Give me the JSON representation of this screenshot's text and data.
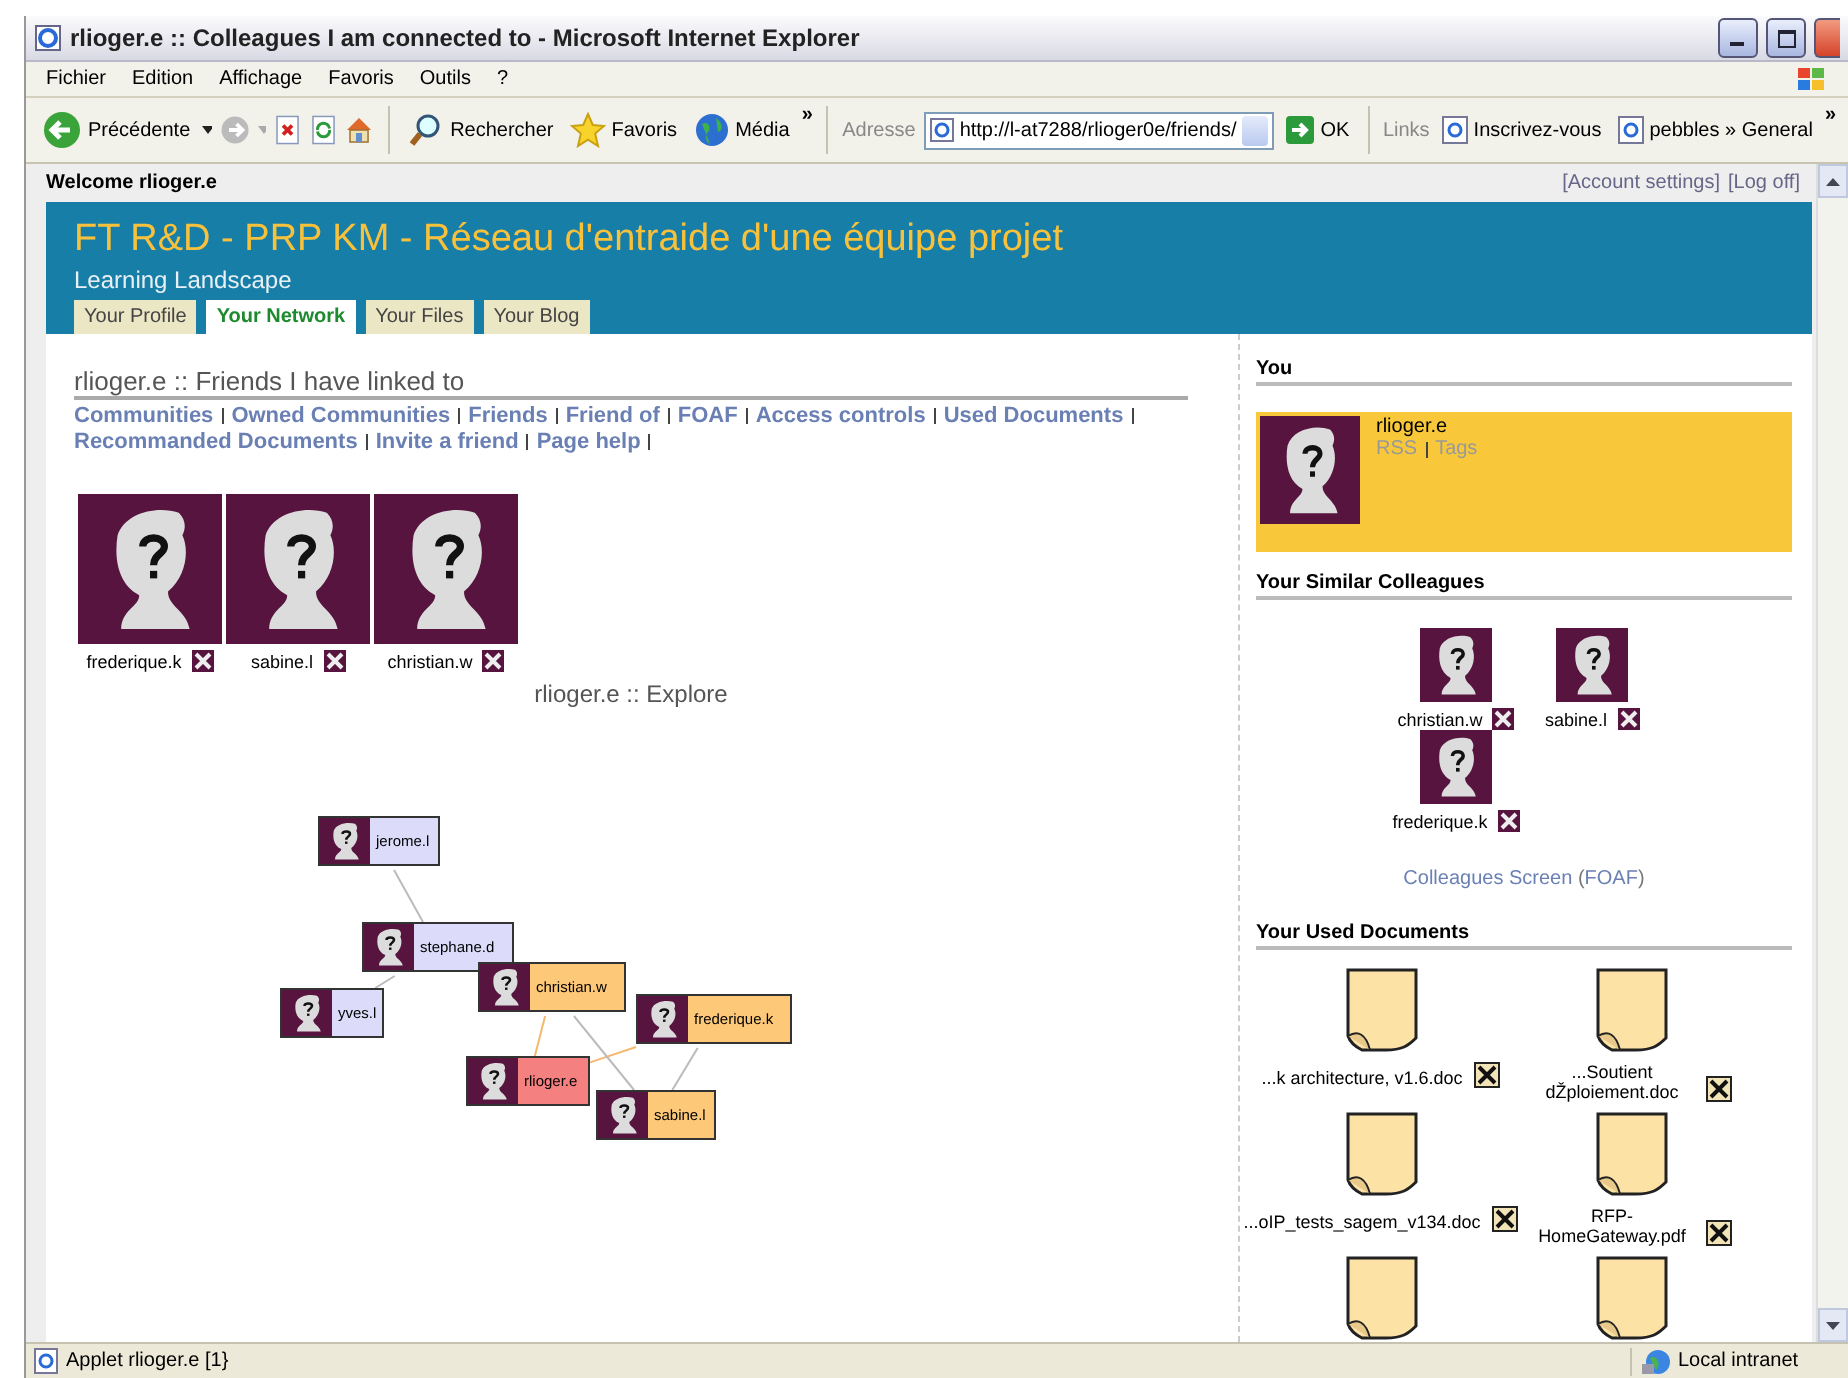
{
  "window": {
    "title": "rlioger.e :: Colleagues I am connected to - Microsoft Internet Explorer"
  },
  "menu": [
    "Fichier",
    "Edition",
    "Affichage",
    "Favoris",
    "Outils",
    "?"
  ],
  "toolbar": {
    "back": "Précédente",
    "search": "Rechercher",
    "favorites": "Favoris",
    "media": "Média",
    "more": "»",
    "address_label": "Adresse",
    "url": "http://l-at7288/rlioger0e/friends/",
    "go": "OK",
    "links_label": "Links",
    "links": [
      "Inscrivez-vous",
      "pebbles » General"
    ],
    "links_more": "»"
  },
  "page": {
    "welcome": "Welcome rlioger.e",
    "account_links": [
      "[Account settings]",
      "[Log off]"
    ],
    "site_title": "FT R&D - PRP KM - Réseau d'entraide d'une équipe projet",
    "subtitle": "Learning Landscape",
    "tabs": [
      {
        "label": "Your Profile",
        "selected": false
      },
      {
        "label": "Your Network",
        "selected": true
      },
      {
        "label": "Your Files",
        "selected": false
      },
      {
        "label": "Your Blog",
        "selected": false
      }
    ]
  },
  "friends": {
    "heading": "rlioger.e :: Friends I have linked to",
    "nav": [
      "Communities",
      "Owned Communities",
      "Friends",
      "Friend of",
      "FOAF",
      "Access controls",
      "Used Documents",
      "Recommanded Documents",
      "Invite a friend",
      "Page help"
    ],
    "people": [
      {
        "name": "frederique.k"
      },
      {
        "name": "sabine.l"
      },
      {
        "name": "christian.w"
      }
    ]
  },
  "explore": {
    "title": "rlioger.e :: Explore",
    "nodes": [
      {
        "name": "jerome.l",
        "kind": "other"
      },
      {
        "name": "stephane.d",
        "kind": "other"
      },
      {
        "name": "yves.l",
        "kind": "other"
      },
      {
        "name": "frederique.k",
        "kind": "friend"
      },
      {
        "name": "christian.w",
        "kind": "friend"
      },
      {
        "name": "sabine.l",
        "kind": "friend"
      },
      {
        "name": "rlioger.e",
        "kind": "self"
      }
    ]
  },
  "sidebar": {
    "you": {
      "heading": "You",
      "name": "rlioger.e",
      "links": [
        "RSS",
        "Tags"
      ]
    },
    "similar": {
      "heading": "Your Similar Colleagues",
      "people": [
        {
          "name": "christian.w"
        },
        {
          "name": "sabine.l"
        },
        {
          "name": "frederique.k"
        }
      ],
      "screen_link": "Colleagues Screen",
      "open": "(",
      "foaf": "FOAF",
      "close": ")"
    },
    "documents": {
      "heading": "Your Used Documents",
      "items": [
        {
          "kind": "document",
          "name": "...k architecture, v1.6.doc"
        },
        {
          "kind": "document",
          "name": "...Soutient dŽploiement.doc"
        },
        {
          "kind": "document",
          "name": "...oIP_tests_sagem_v134.doc"
        },
        {
          "kind": "document",
          "name": "RFP-HomeGateway.pdf"
        },
        {
          "kind": "document"
        },
        {
          "kind": "document"
        }
      ]
    }
  },
  "status_bar": {
    "text": "Applet rlioger.e [1}",
    "zone": "Local intranet"
  }
}
